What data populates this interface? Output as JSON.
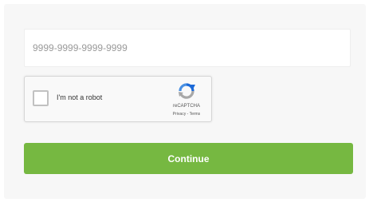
{
  "card_input": {
    "placeholder": "9999-9999-9999-9999",
    "value": ""
  },
  "recaptcha": {
    "label": "I'm not a robot",
    "brand": "reCAPTCHA",
    "privacy_link": "Privacy",
    "separator": " - ",
    "terms_link": "Terms",
    "checked": false,
    "logo_icon": "recaptcha-logo-icon"
  },
  "continue_button": {
    "label": "Continue"
  },
  "colors": {
    "accent_green": "#76b841",
    "background": "#f7f7f7",
    "recaptcha_blue": "#1c6ad8",
    "recaptcha_gray": "#a8a8a8"
  }
}
